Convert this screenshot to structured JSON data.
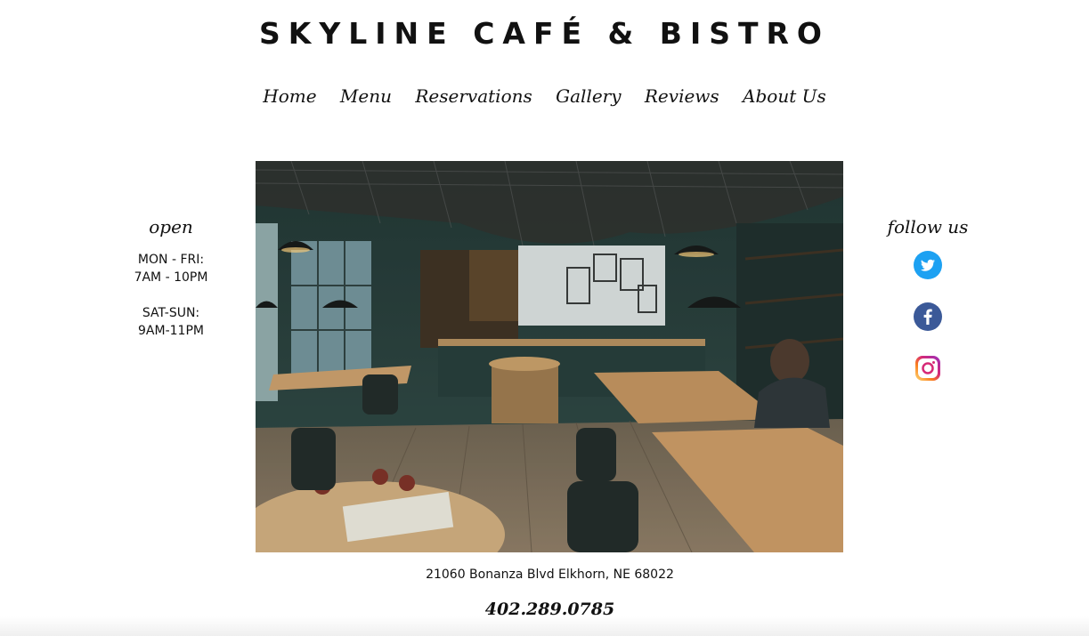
{
  "header": {
    "title": "SKYLINE CAFÉ & BISTRO"
  },
  "nav": {
    "items": [
      "Home",
      "Menu",
      "Reservations",
      "Gallery",
      "Reviews",
      "About Us"
    ]
  },
  "hours": {
    "heading": "open",
    "weekday_days": "MON - FRI:",
    "weekday_time": "7AM - 10PM",
    "weekend_days": "SAT-SUN:",
    "weekend_time": "9AM-11PM"
  },
  "social": {
    "heading": "follow us",
    "icons": [
      "twitter-icon",
      "facebook-icon",
      "instagram-icon"
    ],
    "colors": {
      "twitter": "#1da1f2",
      "facebook": "#3b5998",
      "instagram": "#dd2a7b"
    }
  },
  "hero": {
    "image": "cafe-interior-photo"
  },
  "footer": {
    "address": "21060 Bonanza Blvd Elkhorn, NE 68022",
    "phone": "402.289.0785"
  }
}
